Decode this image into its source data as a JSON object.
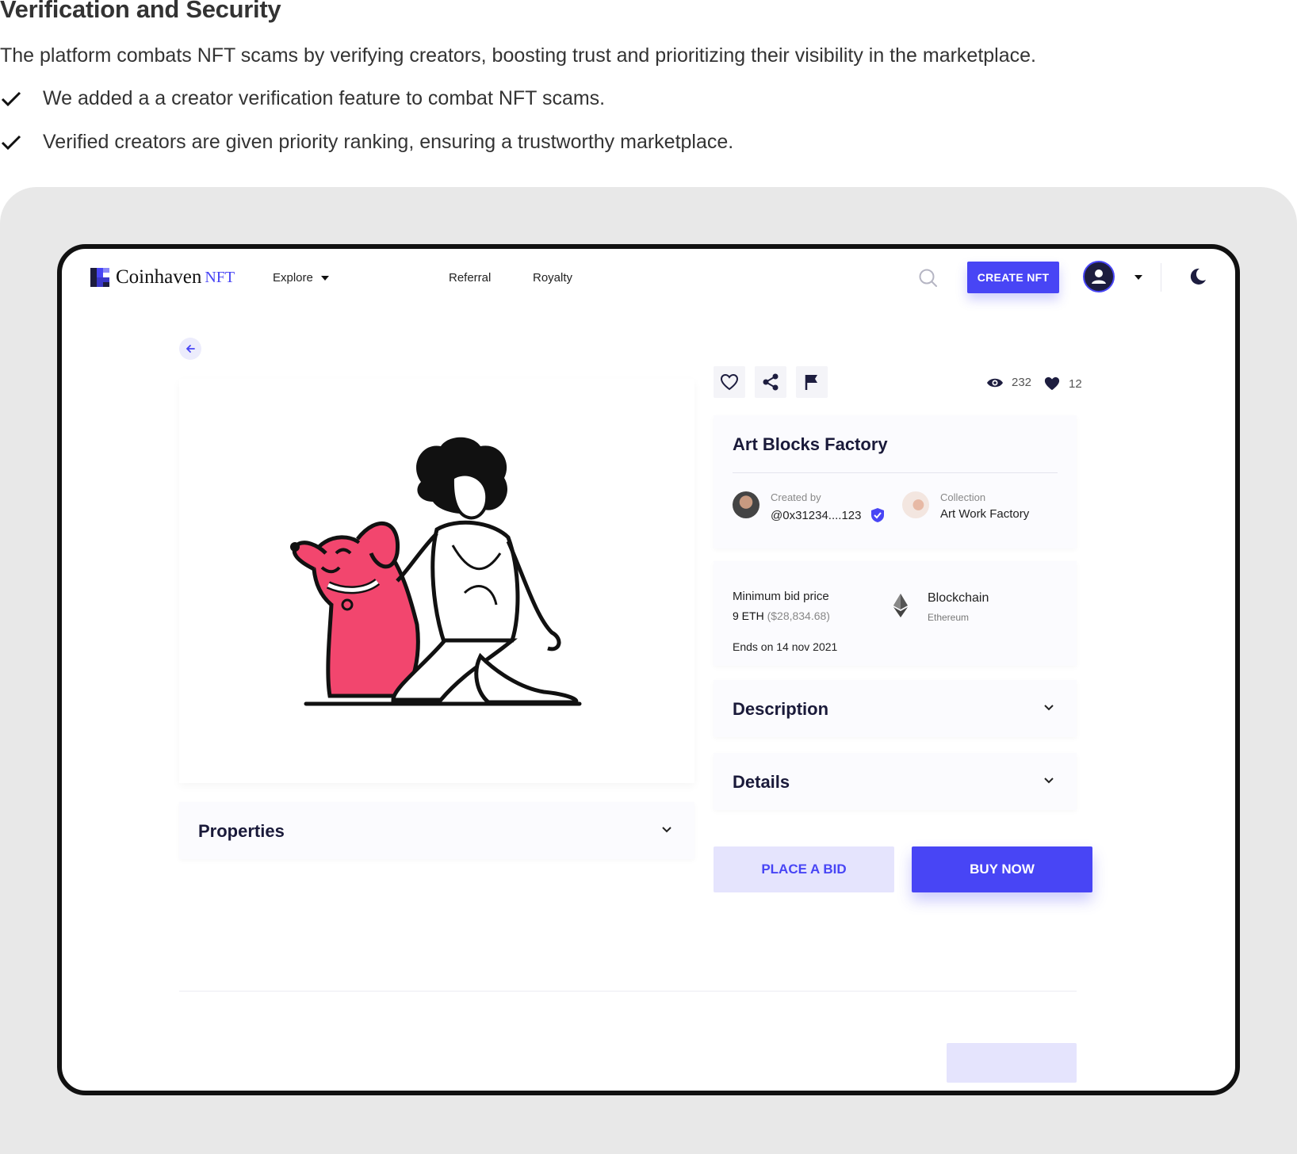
{
  "header": {
    "title": "Verification and Security",
    "intro": "The platform combats NFT scams by verifying creators, boosting trust and prioritizing their visibility in the marketplace.",
    "points": [
      "We added a a creator verification feature to combat NFT scams.",
      "Verified creators are given priority ranking, ensuring a trustworthy marketplace."
    ]
  },
  "app": {
    "brand": {
      "name": "Coinhaven",
      "suffix": "NFT"
    },
    "nav": {
      "explore": "Explore",
      "referral": "Referral",
      "royalty": "Royalty"
    },
    "create_button": "CREATE NFT",
    "stats": {
      "views": "232",
      "likes": "12"
    },
    "nft": {
      "title": "Art Blocks Factory",
      "created_by_label": "Created by",
      "creator": "@0x31234....123",
      "collection_label": "Collection",
      "collection": "Art Work Factory"
    },
    "bid": {
      "min_label": "Minimum bid price",
      "eth_value": "9 ETH",
      "usd_value": "($28,834.68)",
      "ends": "Ends on 14 nov 2021",
      "chain_label": "Blockchain",
      "chain": "Ethereum"
    },
    "sections": {
      "description": "Description",
      "details": "Details",
      "properties": "Properties"
    },
    "buttons": {
      "place_bid": "PLACE A BID",
      "buy_now": "BUY NOW"
    }
  },
  "colors": {
    "accent": "#4845f5",
    "accent_light": "#e5e4fd",
    "verified": "#4845f5",
    "art_pink": "#f2466e",
    "frame_bg": "#e8e8e8"
  },
  "icons": [
    "check-icon",
    "search-icon",
    "user-icon",
    "moon-icon",
    "back-arrow-icon",
    "heart-icon",
    "share-icon",
    "flag-icon",
    "eye-icon",
    "verified-badge-icon",
    "ethereum-icon",
    "chevron-down-icon"
  ]
}
